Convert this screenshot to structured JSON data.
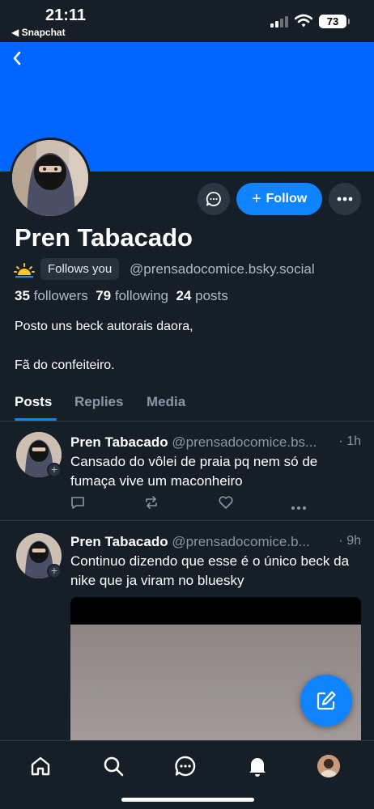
{
  "status_bar": {
    "time": "21:11",
    "back_app": "◀ Snapchat",
    "battery": "73"
  },
  "profile": {
    "display_name": "Pren Tabacado",
    "follows_you_label": "Follows you",
    "handle": "@prensadocomice.bsky.social",
    "followers_count": "35",
    "followers_label": "followers",
    "following_count": "79",
    "following_label": "following",
    "posts_count": "24",
    "posts_label": "posts",
    "bio": "Posto uns beck autorais daora,\n\nFã do confeiteiro.",
    "follow_label": "Follow"
  },
  "colors": {
    "banner": "#0066ff",
    "accent": "#1083fe",
    "background": "#161e27"
  },
  "tabs": [
    {
      "label": "Posts",
      "active": true
    },
    {
      "label": "Replies",
      "active": false
    },
    {
      "label": "Media",
      "active": false
    }
  ],
  "posts": [
    {
      "name": "Pren Tabacado",
      "handle": "@prensadocomice.bs...",
      "time": "· 1h",
      "text": "Cansado do vôlei de praia pq nem só de fumaça vive um maconheiro"
    },
    {
      "name": "Pren Tabacado",
      "handle": "@prensadocomice.b...",
      "time": "· 9h",
      "text": "Continuo dizendo que esse é o único beck da nike que ja viram no bluesky"
    }
  ],
  "icons": {
    "back": "chevron-left-icon",
    "message": "chat-bubble-icon",
    "more": "more-horizontal-icon",
    "compose": "edit-icon",
    "nav": [
      "home-icon",
      "search-icon",
      "chat-icon",
      "bell-icon",
      "profile-avatar"
    ]
  }
}
